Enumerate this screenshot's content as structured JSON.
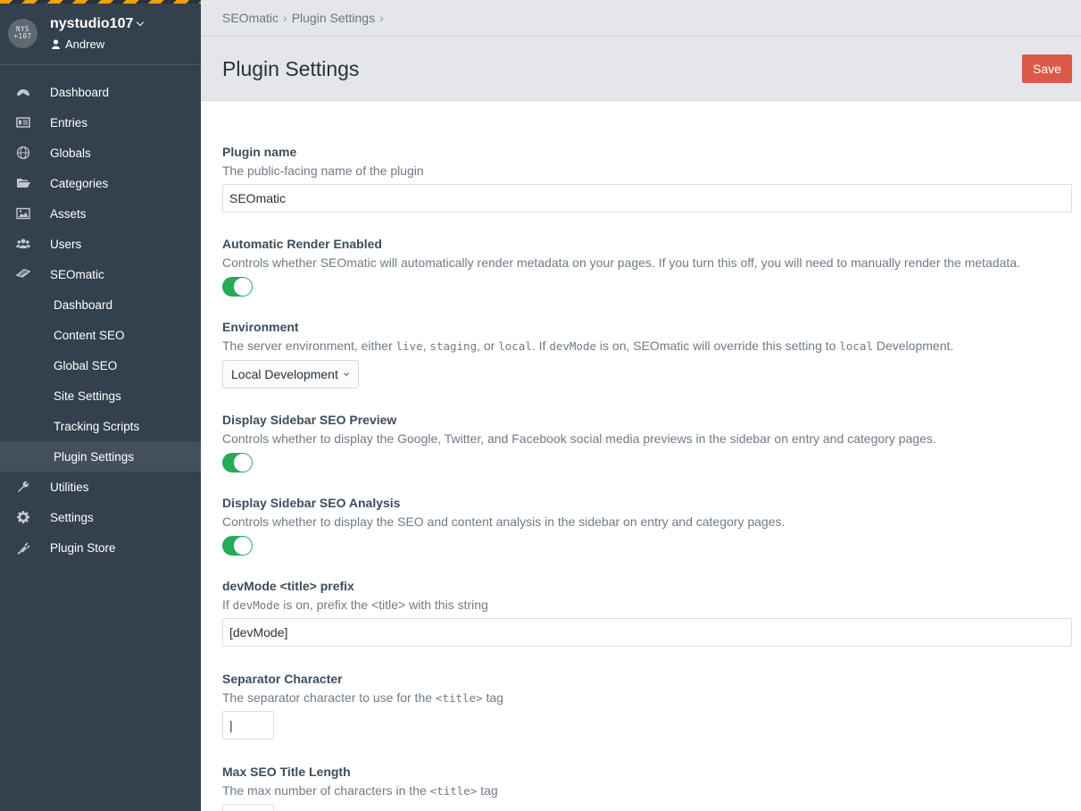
{
  "site": {
    "logo_text": "NYS\n107",
    "name": "nystudio107",
    "user": "Andrew"
  },
  "nav": [
    {
      "label": "Dashboard",
      "icon": "dashboard-icon"
    },
    {
      "label": "Entries",
      "icon": "entries-icon"
    },
    {
      "label": "Globals",
      "icon": "globe-icon"
    },
    {
      "label": "Categories",
      "icon": "folder-icon"
    },
    {
      "label": "Assets",
      "icon": "image-icon"
    },
    {
      "label": "Users",
      "icon": "users-icon"
    },
    {
      "label": "SEOmatic",
      "icon": "seomatic-icon"
    },
    {
      "label": "Dashboard"
    },
    {
      "label": "Content SEO"
    },
    {
      "label": "Global SEO"
    },
    {
      "label": "Site Settings"
    },
    {
      "label": "Tracking Scripts"
    },
    {
      "label": "Plugin Settings",
      "active": true
    },
    {
      "label": "Utilities",
      "icon": "wrench-icon"
    },
    {
      "label": "Settings",
      "icon": "gear-icon"
    },
    {
      "label": "Plugin Store",
      "icon": "plug-icon"
    }
  ],
  "breadcrumbs": [
    "SEOmatic",
    "Plugin Settings"
  ],
  "header": {
    "title": "Plugin Settings",
    "save_label": "Save"
  },
  "fields": {
    "plugin_name": {
      "label": "Plugin name",
      "instructions": "The public-facing name of the plugin",
      "value": "SEOmatic"
    },
    "render": {
      "label": "Automatic Render Enabled",
      "instructions": "Controls whether SEOmatic will automatically render metadata on your pages. If you turn this off, you will need to manually render the metadata.",
      "enabled": true
    },
    "environment": {
      "label": "Environment",
      "instr_parts": [
        "The server environment, either ",
        "live",
        ", ",
        "staging",
        ", or ",
        "local",
        ". If ",
        "devMode",
        " is on, SEOmatic will override this setting to ",
        "local",
        " Development."
      ],
      "value": "Local Development"
    },
    "sidebar_preview": {
      "label": "Display Sidebar SEO Preview",
      "instructions": "Controls whether to display the Google, Twitter, and Facebook social media previews in the sidebar on entry and category pages.",
      "enabled": true
    },
    "sidebar_analysis": {
      "label": "Display Sidebar SEO Analysis",
      "instructions": "Controls whether to display the SEO and content analysis in the sidebar on entry and category pages.",
      "enabled": true
    },
    "devmode_prefix": {
      "label": "devMode <title> prefix",
      "instr_parts": [
        "If ",
        "devMode",
        " is on, prefix the <title> with this string"
      ],
      "value": "[devMode]"
    },
    "separator": {
      "label": "Separator Character",
      "instr_parts": [
        "The separator character to use for the ",
        "<title>",
        " tag"
      ],
      "value": "|"
    },
    "max_title": {
      "label": "Max SEO Title Length",
      "instr_parts": [
        "The max number of characters in the ",
        "<title>",
        " tag"
      ]
    }
  },
  "colors": {
    "sidebar": "#33404d",
    "accent_save": "#da5a47",
    "toggle_on": "#27ab5a",
    "hazard_yellow": "#f2a00c"
  }
}
